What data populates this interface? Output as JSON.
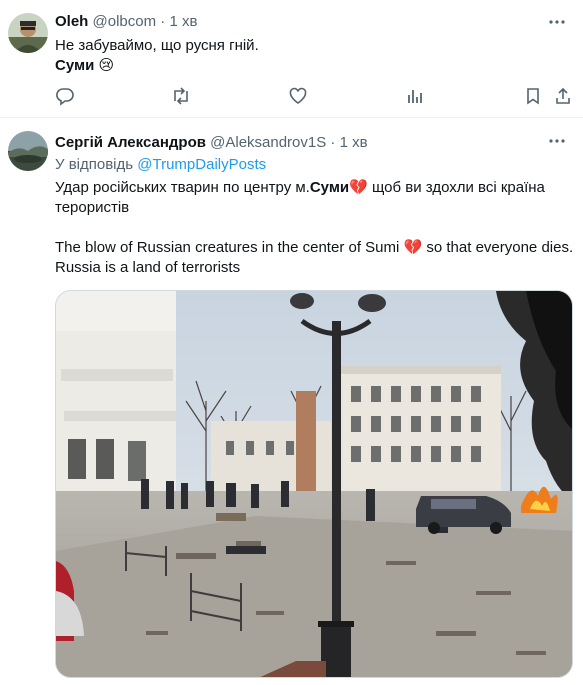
{
  "tweet1": {
    "name": "Oleh",
    "handle": "@olbcom",
    "dot": "·",
    "time": "1 хв",
    "line1": "Не забуваймо, що русня гній.",
    "line2": "Суми",
    "emoji": "😢",
    "icons": [
      "reply-icon",
      "retweet-icon",
      "like-icon",
      "views-icon",
      "bookmark-icon",
      "share-icon"
    ]
  },
  "tweet2": {
    "name": "Сергій Александров",
    "handle": "@Aleksandrov1S",
    "dot": "·",
    "time": "1 хв",
    "reply_prefix": "У відповідь",
    "reply_to": "@TrumpDailyPosts",
    "ua_part1": "Удар російських тварин по центру м.",
    "ua_city": "Суми",
    "ua_part2": " щоб ви здохли всі країна",
    "ua_line2": "терористів",
    "en_part1": "The blow of Russian creatures in the center of Sumi ",
    "en_part2": " so that everyone dies.",
    "en_line2": "Russia is a land of terrorists",
    "emoji": "💔"
  },
  "colors": {
    "link": "#1d9bf0",
    "muted": "#536471",
    "border": "#eff3f4"
  }
}
